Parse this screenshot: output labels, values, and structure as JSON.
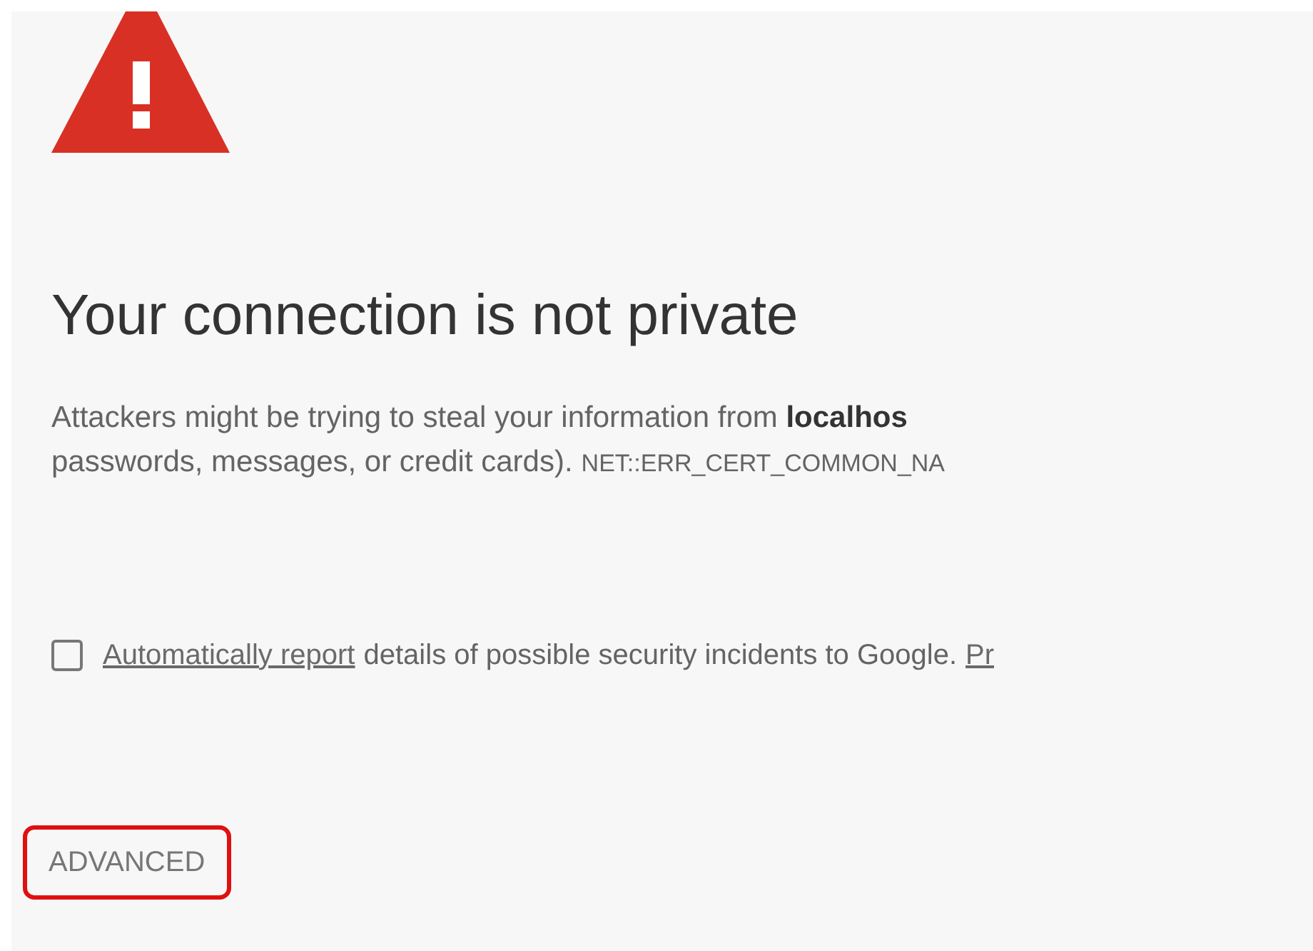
{
  "title": "Your connection is not private",
  "description": {
    "text": "Attackers might be trying to steal your information from **localhos**",
    "text_2": "passwords, messages, or credit cards).",
    "error_code": "NET::ERR_CERT_COMMON_NA"
  },
  "report": {
    "checked": false,
    "link": "Automatically report",
    "text": "details of possible security incidents to Google.",
    "link_2": "Pr"
  },
  "advanced_button": {
    "label": "ADVANCED",
    "highlighted": true
  }
}
